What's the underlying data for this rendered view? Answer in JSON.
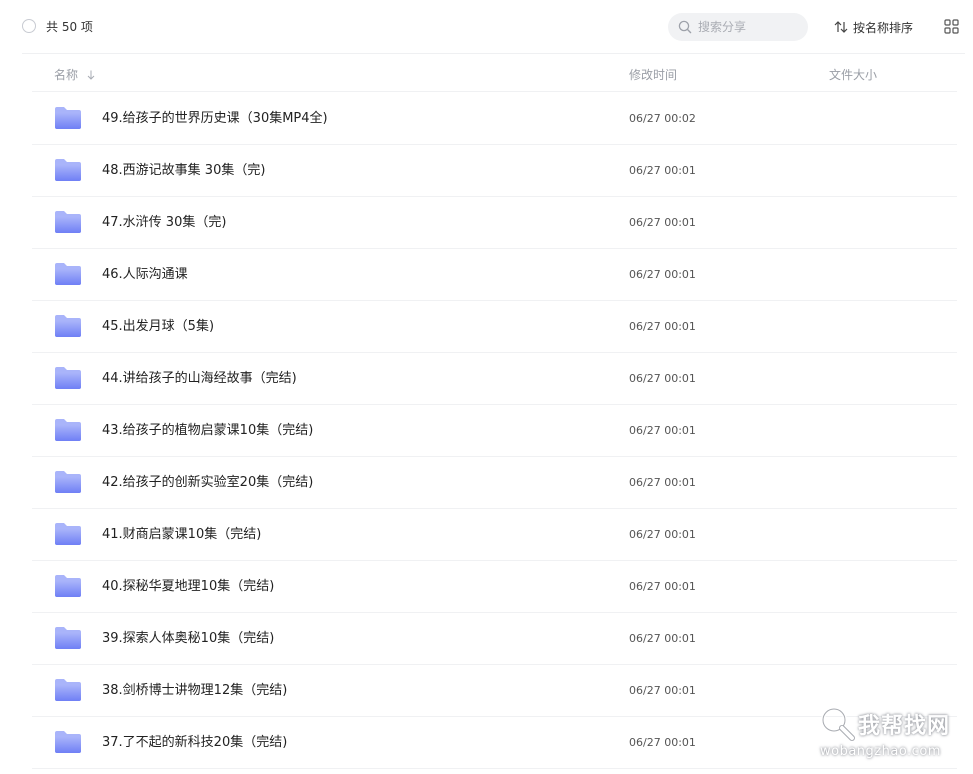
{
  "toolbar": {
    "count_text": "共 50 项",
    "search_placeholder": "搜索分享",
    "sort_label": "按名称排序"
  },
  "table": {
    "headers": {
      "name": "名称",
      "modified": "修改时间",
      "size": "文件大小"
    },
    "rows": [
      {
        "name": "49.给孩子的世界历史课（30集MP4全)",
        "modified": "06/27 00:02",
        "size": ""
      },
      {
        "name": "48.西游记故事集 30集（完)",
        "modified": "06/27 00:01",
        "size": ""
      },
      {
        "name": "47.水浒传 30集（完)",
        "modified": "06/27 00:01",
        "size": ""
      },
      {
        "name": "46.人际沟通课",
        "modified": "06/27 00:01",
        "size": ""
      },
      {
        "name": "45.出发月球（5集)",
        "modified": "06/27 00:01",
        "size": ""
      },
      {
        "name": "44.讲给孩子的山海经故事（完结)",
        "modified": "06/27 00:01",
        "size": ""
      },
      {
        "name": "43.给孩子的植物启蒙课10集（完结)",
        "modified": "06/27 00:01",
        "size": ""
      },
      {
        "name": "42.给孩子的创新实验室20集（完结)",
        "modified": "06/27 00:01",
        "size": ""
      },
      {
        "name": "41.财商启蒙课10集（完结)",
        "modified": "06/27 00:01",
        "size": ""
      },
      {
        "name": "40.探秘华夏地理10集（完结)",
        "modified": "06/27 00:01",
        "size": ""
      },
      {
        "name": "39.探索人体奥秘10集（完结)",
        "modified": "06/27 00:01",
        "size": ""
      },
      {
        "name": "38.剑桥博士讲物理12集（完结)",
        "modified": "06/27 00:01",
        "size": ""
      },
      {
        "name": "37.了不起的新科技20集（完结)",
        "modified": "06/27 00:01",
        "size": ""
      }
    ]
  },
  "watermark": {
    "title": "我帮找网",
    "subtitle": "wobangzhao.com"
  },
  "colors": {
    "folder_top": "#a9b4fa",
    "folder_bottom": "#6f7ff5",
    "divider": "#f0f1f3",
    "search_bg": "#f1f2f4"
  }
}
